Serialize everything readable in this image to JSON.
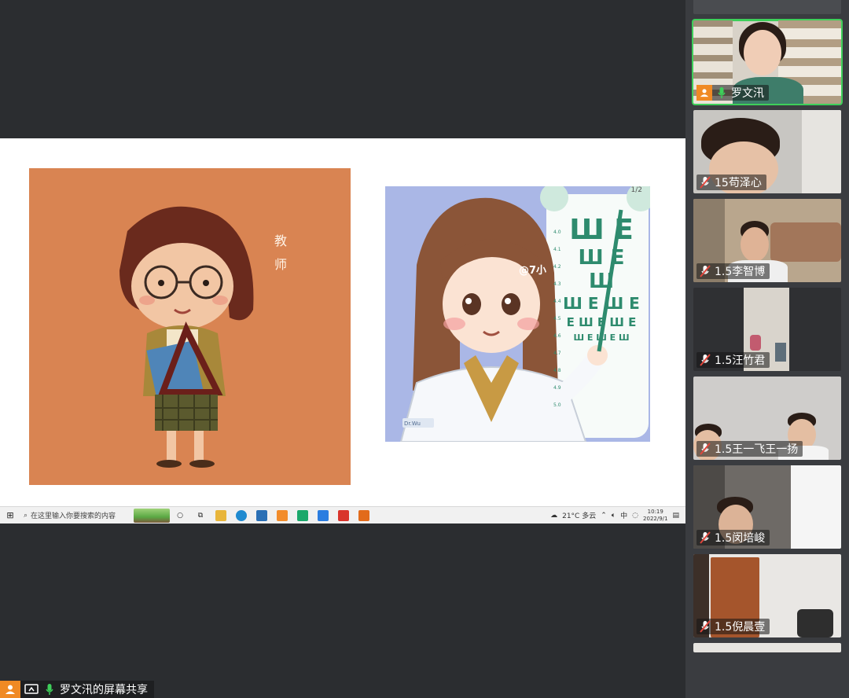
{
  "slide": {
    "label_line1": "教",
    "label_line2": "师",
    "doctor_watermark": "@7小",
    "doctor_badge": "Dr.Wu",
    "page_indicator": "1/2",
    "eye_chart_rows": [
      "Ш E",
      "Ш E Ш",
      "Ш E Ш E",
      "E Ш E Ш E",
      "Ш E Ш E Ш"
    ],
    "eye_chart_scale": [
      "4.0",
      "4.1",
      "4.2",
      "4.3",
      "4.4",
      "4.5",
      "4.6",
      "4.7",
      "4.8",
      "4.9",
      "5.0"
    ]
  },
  "taskbar": {
    "search_placeholder": "在这里输入你要搜索的内容",
    "weather": "21°C 多云",
    "ime": "中",
    "time": "10:19",
    "date": "2022/9/1"
  },
  "share": {
    "label": "罗文汛的屏幕共享"
  },
  "participants": [
    {
      "name": "罗文汛",
      "mic": "on",
      "host": true
    },
    {
      "name": "15苟泽心",
      "mic": "muted",
      "host": false
    },
    {
      "name": "1.5李智博",
      "mic": "muted",
      "host": false
    },
    {
      "name": "1.5汪竹君",
      "mic": "muted",
      "host": false
    },
    {
      "name": "1.5王一飞王一扬",
      "mic": "muted",
      "host": false
    },
    {
      "name": "1.5闵培峻",
      "mic": "muted",
      "host": false
    },
    {
      "name": "1.5倪晨壹",
      "mic": "muted",
      "host": false
    }
  ],
  "colors": {
    "accent_green": "#3ecf5a",
    "host_orange": "#f08a24",
    "muted_red": "#e0463c",
    "slide_orange": "#d98452"
  }
}
